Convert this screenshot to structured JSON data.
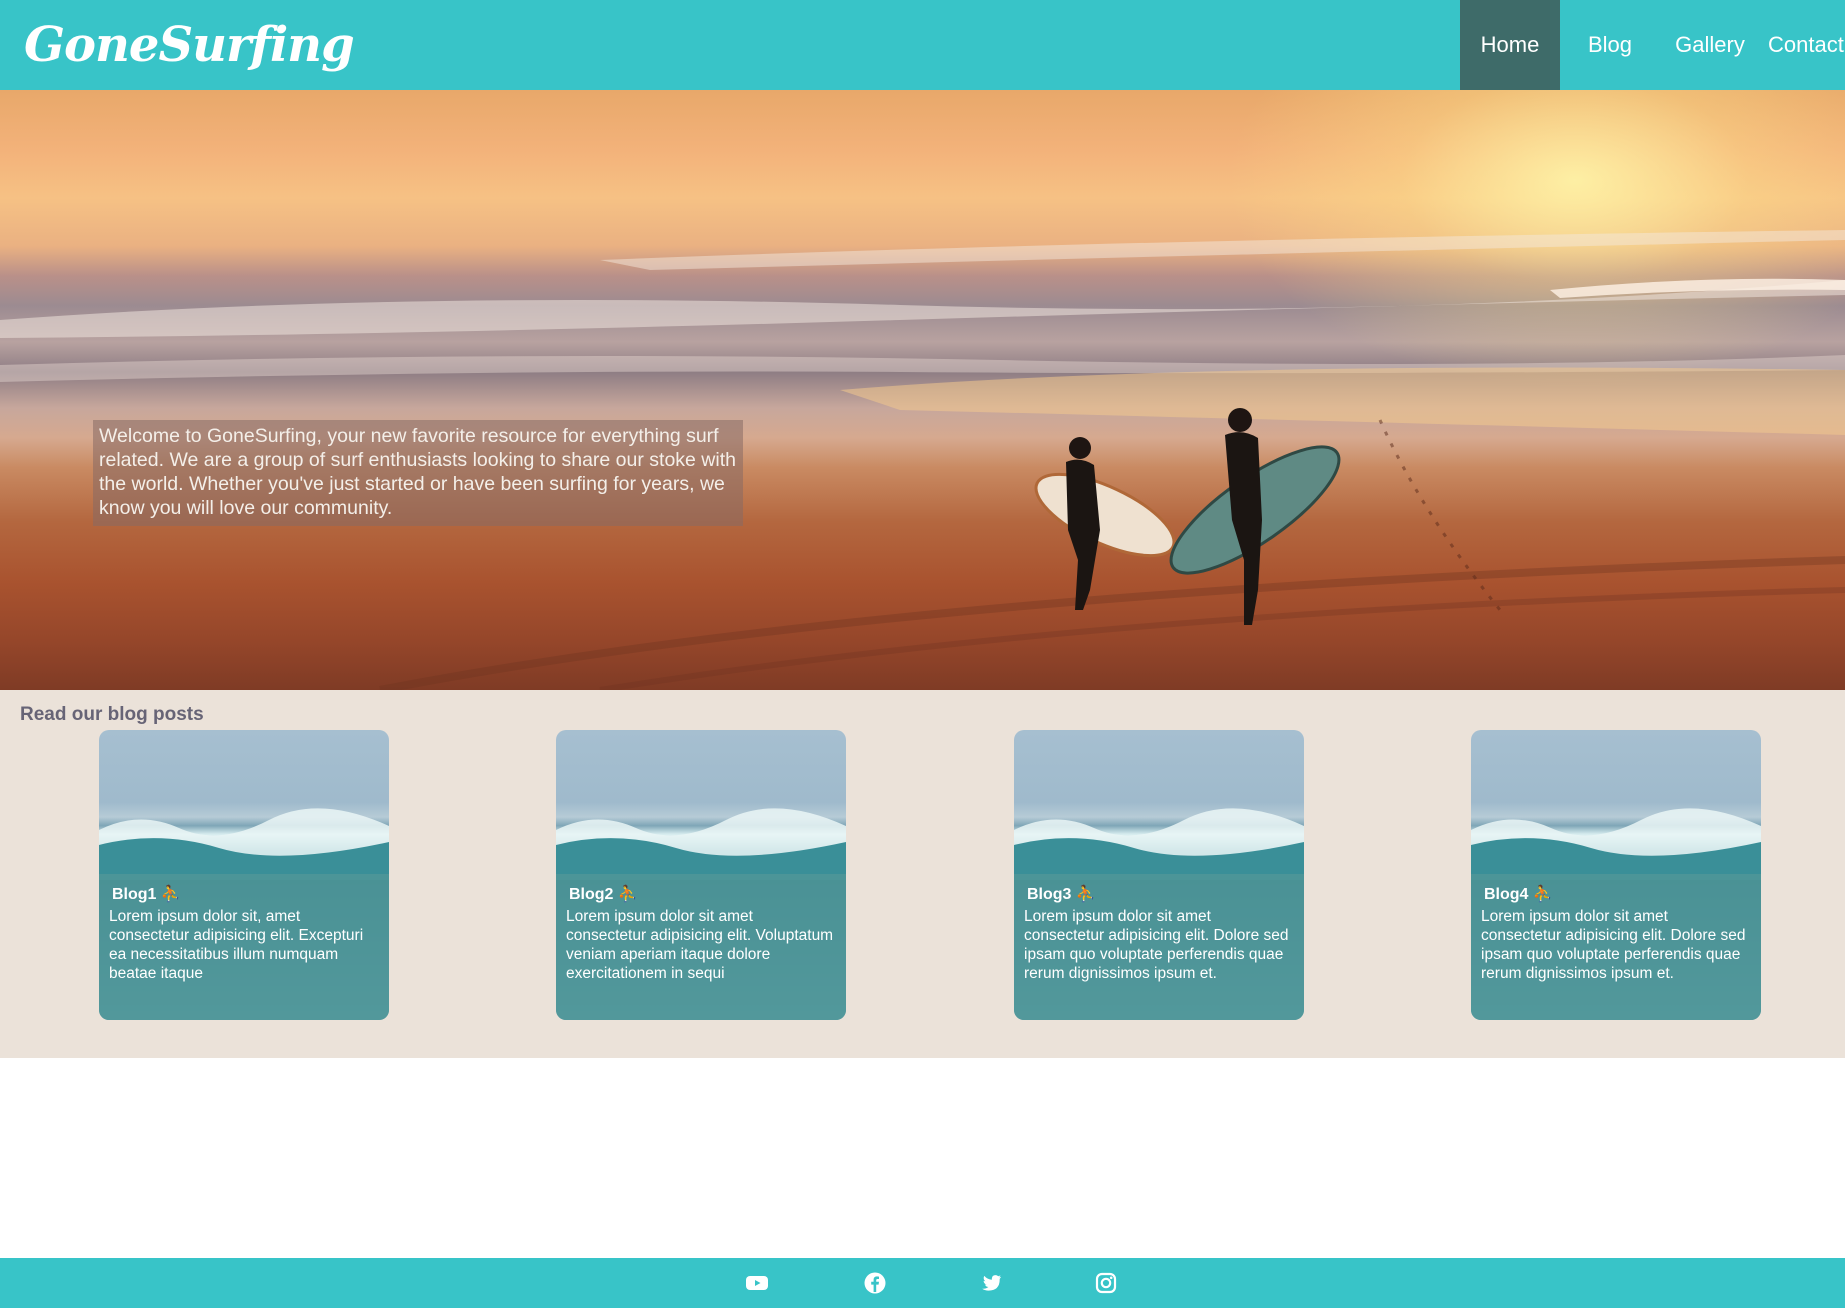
{
  "brand": {
    "logo_text": "GoneSurfing"
  },
  "nav": {
    "items": [
      {
        "label": "Home",
        "active": true
      },
      {
        "label": "Blog",
        "active": false
      },
      {
        "label": "Gallery",
        "active": false
      },
      {
        "label": "Contact",
        "active": false
      }
    ]
  },
  "hero": {
    "text": "Welcome to GoneSurfing, your new favorite resource for everything surf related. We are a group of surf enthusiasts looking to share our stoke with the world. Whether you've just started or have been surfing for years, we know you will love our community."
  },
  "blog": {
    "section_title": "Read our blog posts",
    "cards": [
      {
        "title": "Blog1",
        "body": "Lorem ipsum dolor sit, amet consectetur adipisicing elit. Excepturi ea necessitatibus illum numquam beatae itaque"
      },
      {
        "title": "Blog2",
        "body": "Lorem ipsum dolor sit amet consectetur adipisicing elit. Voluptatum veniam aperiam itaque dolore exercitationem in sequi"
      },
      {
        "title": "Blog3",
        "body": "Lorem ipsum dolor sit amet consectetur adipisicing elit. Dolore sed ipsam quo voluptate perferendis quae rerum dignissimos ipsum et."
      },
      {
        "title": "Blog4",
        "body": "Lorem ipsum dolor sit amet consectetur adipisicing elit. Dolore sed ipsam quo voluptate perferendis quae rerum dignissimos ipsum et."
      }
    ]
  },
  "footer": {
    "social": [
      {
        "icon": "youtube-icon"
      },
      {
        "icon": "facebook-icon"
      },
      {
        "icon": "twitter-icon"
      },
      {
        "icon": "instagram-icon"
      }
    ]
  },
  "colors": {
    "primary": "#38c4c8",
    "nav_active": "#3e6b69",
    "section_bg": "#ebe2d9",
    "section_title": "#676476"
  }
}
